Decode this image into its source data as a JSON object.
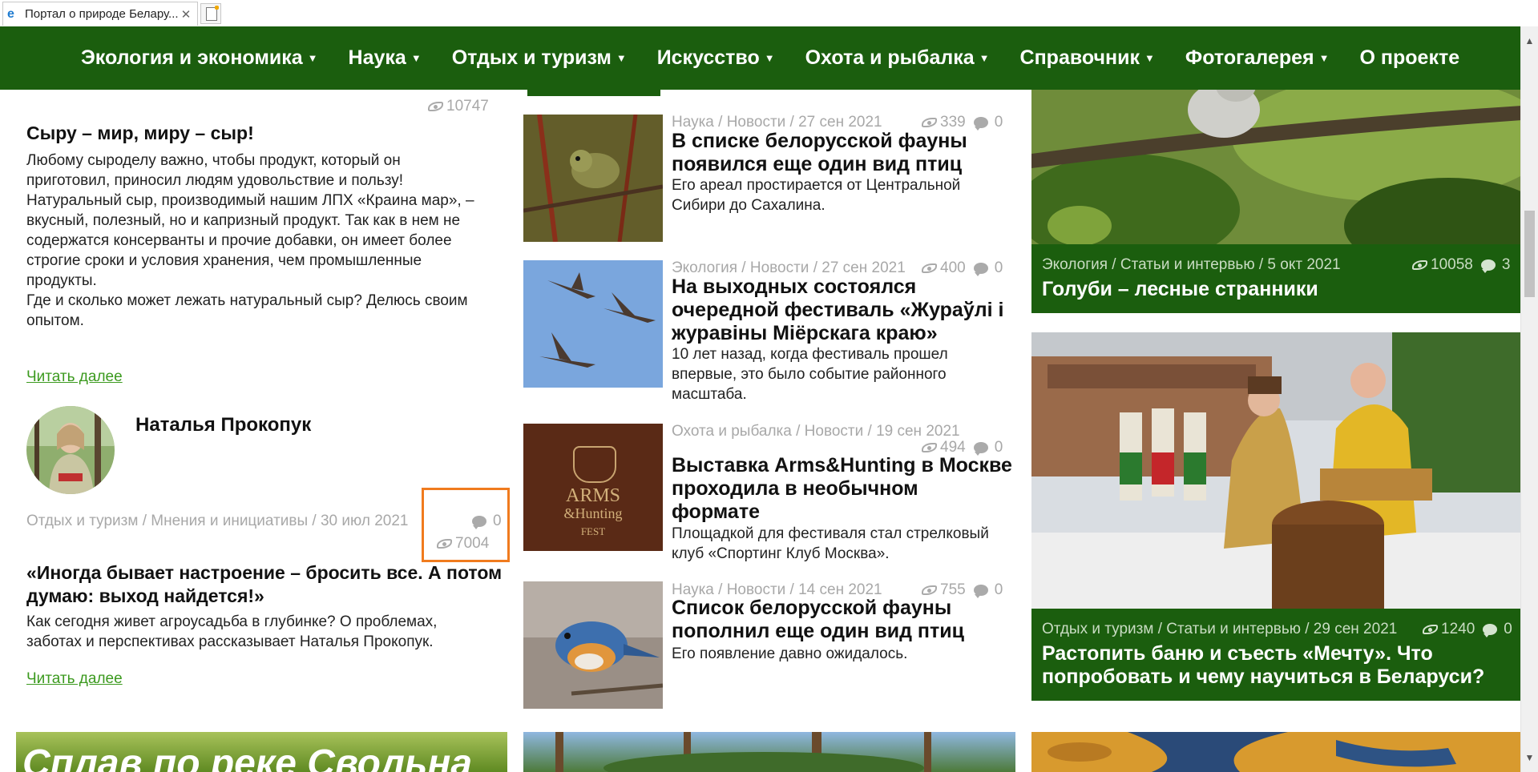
{
  "browser": {
    "tab_title": "Портал о природе Белару...",
    "tab_close": "✕"
  },
  "menu": [
    {
      "label": "Экология и экономика",
      "has_dropdown": true
    },
    {
      "label": "Наука",
      "has_dropdown": true
    },
    {
      "label": "Отдых и туризм",
      "has_dropdown": true
    },
    {
      "label": "Искусство",
      "has_dropdown": true
    },
    {
      "label": "Охота и рыбалка",
      "has_dropdown": true
    },
    {
      "label": "Справочник",
      "has_dropdown": true
    },
    {
      "label": "Фотогалерея",
      "has_dropdown": true
    },
    {
      "label": "О проекте",
      "has_dropdown": false
    }
  ],
  "caret": "▼",
  "left": {
    "top_views": "10747",
    "article1": {
      "title": "Сыру – мир, миру – сыр!",
      "body": [
        "Любому сыроделу важно, чтобы продукт, который он",
        "приготовил, приносил людям удовольствие и пользу!",
        "Натуральный сыр, производимый нашим ЛПХ «Краина мар», –",
        "вкусный, полезный, но и капризный продукт. Так как в нем не",
        "содержатся консерванты и прочие добавки, он имеет более",
        "строгие сроки и условия хранения, чем промышленные",
        "продукты.",
        "Где и сколько может лежать натуральный сыр? Делюсь своим",
        "опытом."
      ],
      "read_more": "Читать далее"
    },
    "author": {
      "name": "Наталья Прокопук"
    },
    "article2": {
      "meta": "Отдых и туризм / Мнения и инициативы / 30 июл 2021",
      "comments": "0",
      "views": "7004",
      "title_lines": [
        "«Иногда бывает настроение – бросить все. А потом",
        "думаю: выход найдется!»"
      ],
      "body": [
        "Как сегодня живет агроусадьба в глубинке? О проблемах,",
        "заботах и перспективах рассказывает Наталья Прокопук."
      ],
      "read_more": "Читать далее"
    },
    "highlight_color": "#f07b1e"
  },
  "middle": [
    {
      "meta": "Наука / Новости / 27 сен 2021",
      "views": "339",
      "comments": "0",
      "title_lines": [
        "В списке белорусской фауны",
        "появился еще один вид птиц"
      ],
      "body": [
        "Его ареал простирается от Центральной",
        "Сибири до Сахалина."
      ]
    },
    {
      "meta": "Экология / Новости / 27 сен 2021",
      "views": "400",
      "comments": "0",
      "title_lines": [
        "На выходных состоялся",
        "очередной фестиваль «Жураўлі і",
        "журавіны Міёрскага краю»"
      ],
      "body": [
        "10 лет назад, когда фестиваль прошел",
        "впервые, это было событие районного",
        "масштаба."
      ]
    },
    {
      "meta": "Охота и рыбалка / Новости / 19 сен 2021",
      "views": "494",
      "comments": "0",
      "title_lines": [
        "Выставка Arms&Hunting в Москве",
        "проходила в необычном",
        "формате"
      ],
      "body": [
        "Площадкой для фестиваля стал стрелковый",
        "клуб «Спортинг Клуб Москва»."
      ],
      "logo": {
        "line1": "ARMS",
        "line2": "&Hunting",
        "line3": "FEST"
      }
    },
    {
      "meta": "Наука / Новости / 14 сен 2021",
      "views": "755",
      "comments": "0",
      "title_lines": [
        "Список белорусской фауны",
        "пополнил еще один вид птиц"
      ],
      "body": [
        "Его появление давно ожидалось."
      ]
    }
  ],
  "right": [
    {
      "meta": "Экология / Статьи и интервью / 5 окт 2021",
      "views": "10058",
      "comments": "3",
      "title_lines": [
        "Голуби – лесные странники"
      ]
    },
    {
      "meta": "Отдых и туризм / Статьи и интервью / 29 сен 2021",
      "views": "1240",
      "comments": "0",
      "title_lines": [
        "Растопить баню и съесть «Мечту». Что",
        "попробовать и чему научиться в Беларуси?"
      ]
    }
  ],
  "bottom_banner_text": "Сплав по реке Свольна",
  "colors": {
    "menu_green": "#1b5e0e",
    "link_green": "#3c9a1f",
    "meta_gray": "#a8a8a8"
  },
  "scroll_arrows": {
    "up": "▲",
    "down": "▼"
  }
}
